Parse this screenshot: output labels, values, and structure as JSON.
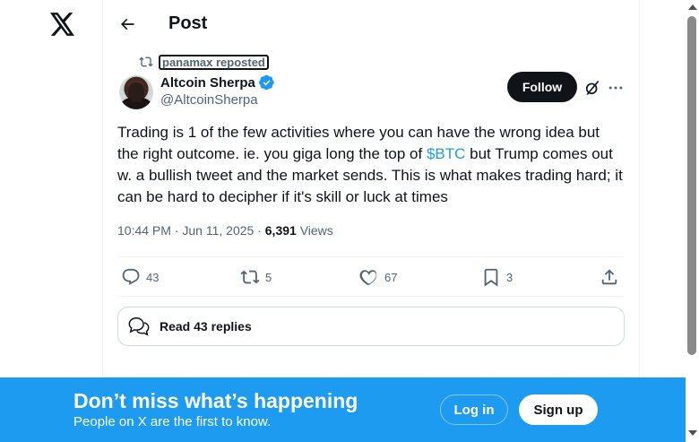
{
  "header": {
    "title": "Post",
    "back_icon": "arrow-left-icon",
    "logo_icon": "x-logo-icon"
  },
  "repost": {
    "label": "panamax reposted",
    "icon": "repost-icon"
  },
  "author": {
    "name": "Altcoin Sherpa",
    "handle": "@AltcoinSherpa",
    "verified": true,
    "verified_color": "#1d9bf0"
  },
  "follow_button": {
    "label": "Follow"
  },
  "tweet": {
    "text_before": "Trading is 1 of the few activities where you can have the wrong idea but the right outcome. ie. you giga long the top of ",
    "cashtag": "$BTC",
    "text_after": " but Trump comes out w. a bullish tweet and the market sends. This is what makes trading hard; it can be hard to decipher if it's skill or luck at times"
  },
  "meta": {
    "time": "10:44 PM",
    "separator1": " · ",
    "date": "Jun 11, 2025",
    "separator2": " · ",
    "views_count": "6,391",
    "views_label": " Views"
  },
  "actions": {
    "replies": "43",
    "reposts": "5",
    "likes": "67",
    "bookmarks": "3"
  },
  "read_replies": {
    "label": "Read 43 replies"
  },
  "banner": {
    "title": "Don’t miss what’s happening",
    "subtitle": "People on X are the first to know.",
    "login_label": "Log in",
    "signup_label": "Sign up",
    "background": "#1d9bf0"
  },
  "colors": {
    "text": "#0f1419",
    "muted": "#536471",
    "accent": "#1d9bf0",
    "border": "#eff3f4"
  }
}
